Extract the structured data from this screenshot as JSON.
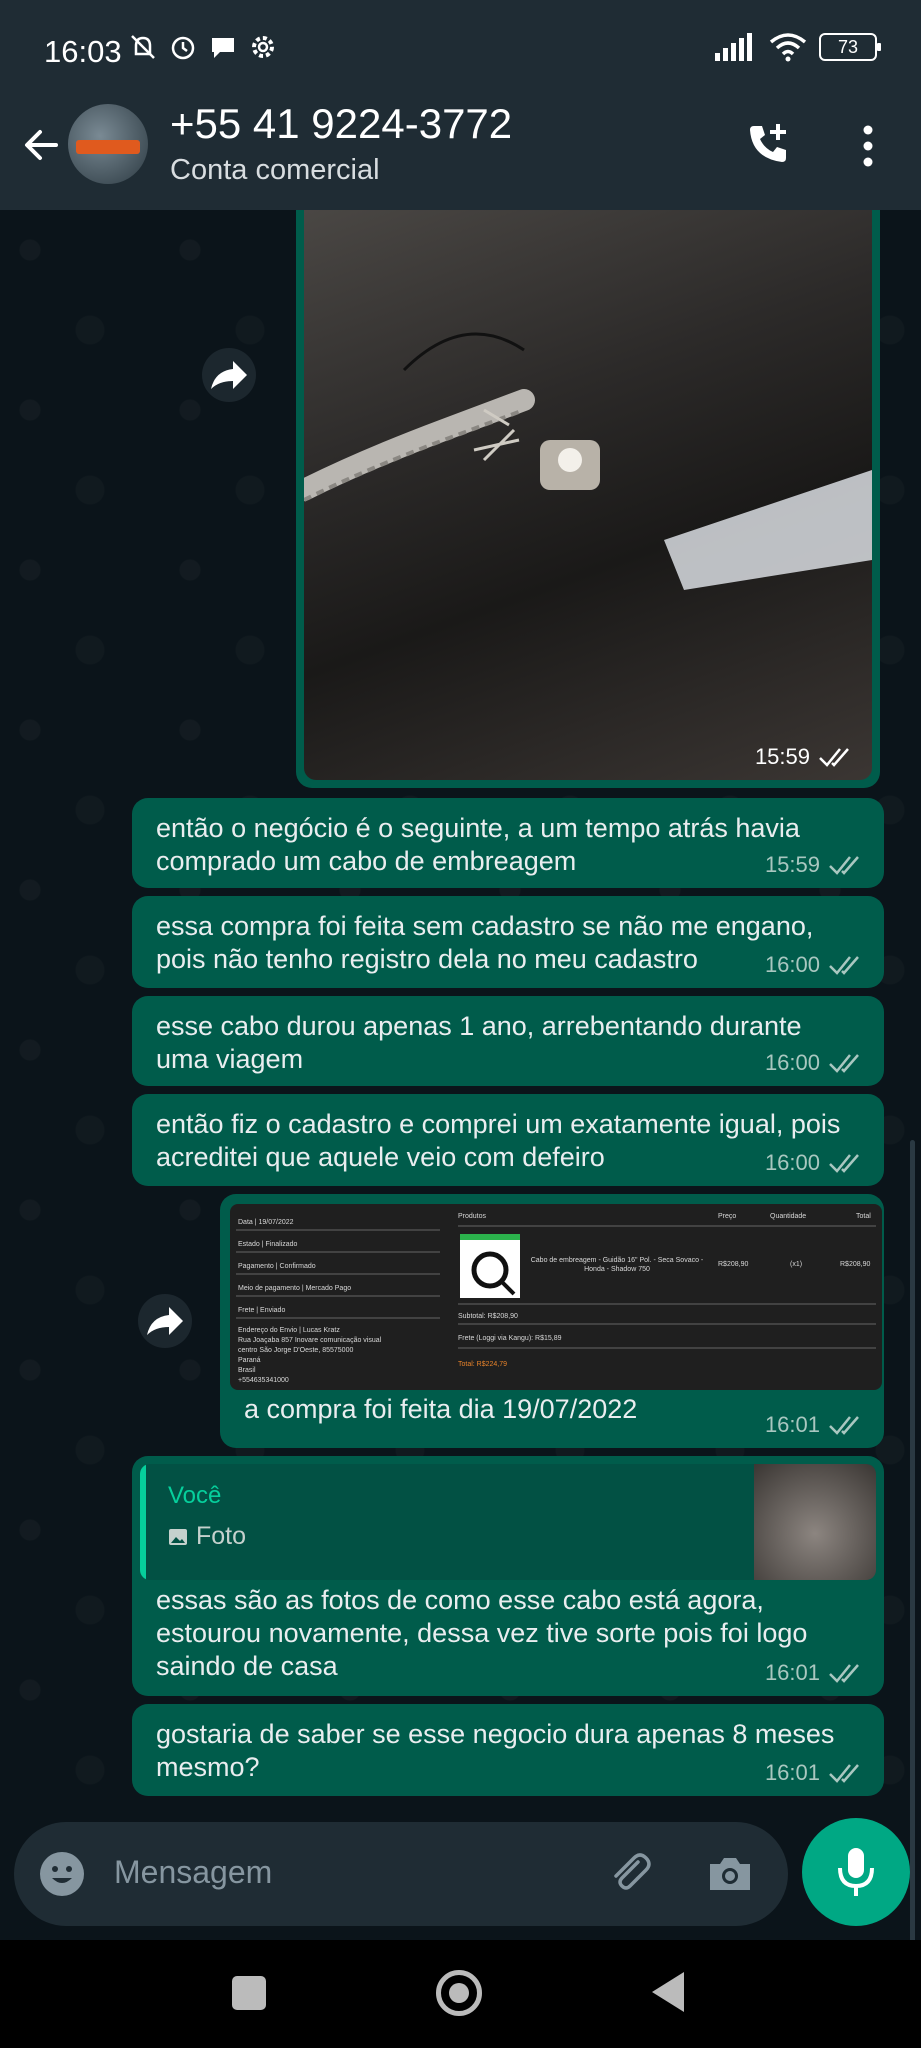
{
  "status_bar": {
    "time": "16:03",
    "battery": "73"
  },
  "header": {
    "title": "+55 41 9224-3772",
    "subtitle": "Conta comercial"
  },
  "messages": [
    {
      "type": "image",
      "time": "15:59"
    },
    {
      "type": "text",
      "text": "então o negócio é o seguinte, a um tempo atrás havia comprado um cabo de embreagem",
      "time": "15:59"
    },
    {
      "type": "text",
      "text": "essa compra foi feita sem cadastro se não me engano, pois não tenho registro dela no meu cadastro",
      "time": "16:00"
    },
    {
      "type": "text",
      "text": "esse cabo durou apenas 1 ano, arrebentando durante uma viagem",
      "time": "16:00"
    },
    {
      "type": "text",
      "text": "então fiz o cadastro e comprei um exatamente igual, pois acreditei que aquele veio com defeiro",
      "time": "16:00"
    },
    {
      "type": "image",
      "caption": "a compra foi feita dia 19/07/2022",
      "time": "16:01",
      "receipt": {
        "left_rows": [
          "Data | 19/07/2022",
          "Estado | Finalizado",
          "Pagamento | Confirmado",
          "Meio de pagamento | Mercado Pago",
          "Frete | Enviado"
        ],
        "address_title": "Endereço do Envio | Lucas Kratz",
        "address_lines": [
          "Rua Joaçaba 857 Inovare comunicação visual",
          "centro São Jorge D'Oeste, 85575000",
          "Paraná",
          "Brasil",
          "+554635341000"
        ],
        "headers": [
          "Produtos",
          "Preço",
          "Quantidade",
          "Total"
        ],
        "product": "Cabo de embreagem - Guidão 16\" Pol. - Seca Sovaco - Honda - Shadow 750",
        "price": "R$208,90",
        "qty": "(x1)",
        "total": "R$208,90",
        "subtotal": "Subtotal: R$208,90",
        "frete": "Frete (Loggi via Kangu): R$15,89",
        "total_label": "Total: R$224,79"
      }
    },
    {
      "type": "reply",
      "quote_name": "Você",
      "quote_type": "Foto",
      "text": "essas são as fotos de como esse cabo está agora, estourou novamente, dessa vez tive sorte pois foi logo saindo de casa",
      "time": "16:01"
    },
    {
      "type": "text",
      "text": "gostaria de saber se esse negocio dura apenas 8 meses mesmo?",
      "time": "16:01"
    }
  ],
  "input": {
    "placeholder": "Mensagem"
  },
  "colors": {
    "bubble": "#005c4b",
    "accent": "#00a884",
    "background": "#0b141a",
    "bar": "#1f2c34"
  }
}
